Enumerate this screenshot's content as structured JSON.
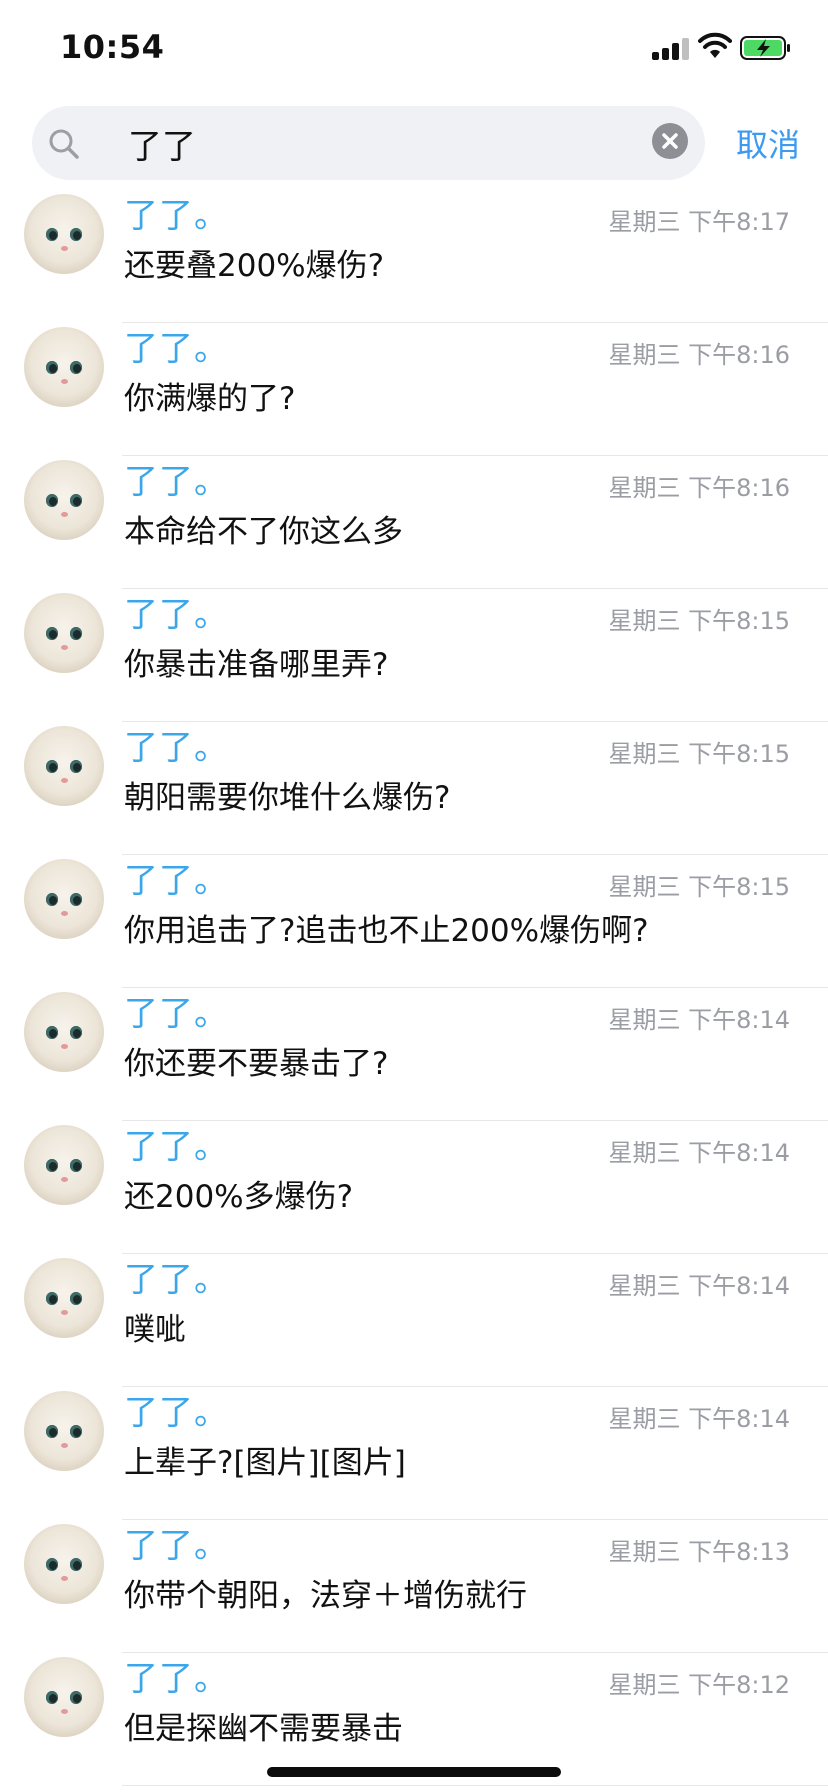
{
  "status_bar": {
    "time": "10:54"
  },
  "search": {
    "query": "了了",
    "cancel_label": "取消"
  },
  "results": [
    {
      "sender": "了了。",
      "time": "星期三 下午8:17",
      "message": "还要叠200%爆伤?"
    },
    {
      "sender": "了了。",
      "time": "星期三 下午8:16",
      "message": "你满爆的了?"
    },
    {
      "sender": "了了。",
      "time": "星期三 下午8:16",
      "message": "本命给不了你这么多"
    },
    {
      "sender": "了了。",
      "time": "星期三 下午8:15",
      "message": "你暴击准备哪里弄?"
    },
    {
      "sender": "了了。",
      "time": "星期三 下午8:15",
      "message": "朝阳需要你堆什么爆伤?"
    },
    {
      "sender": "了了。",
      "time": "星期三 下午8:15",
      "message": "你用追击了?追击也不止200%爆伤啊?"
    },
    {
      "sender": "了了。",
      "time": "星期三 下午8:14",
      "message": "你还要不要暴击了?"
    },
    {
      "sender": "了了。",
      "time": "星期三 下午8:14",
      "message": "还200%多爆伤?"
    },
    {
      "sender": "了了。",
      "time": "星期三 下午8:14",
      "message": "噗呲"
    },
    {
      "sender": "了了。",
      "time": "星期三 下午8:14",
      "message": "上辈子?[图片][图片]"
    },
    {
      "sender": "了了。",
      "time": "星期三 下午8:13",
      "message": "你带个朝阳，法穿＋增伤就行"
    },
    {
      "sender": "了了。",
      "time": "星期三 下午8:12",
      "message": "但是探幽不需要暴击"
    }
  ],
  "icons": {
    "search": "search-icon",
    "clear": "clear-icon",
    "signal": "signal-icon",
    "wifi": "wifi-icon",
    "battery": "battery-charging-icon"
  },
  "colors": {
    "accent": "#3c9bf0",
    "sender": "#3ba7ea",
    "battery": "#4cd964"
  }
}
